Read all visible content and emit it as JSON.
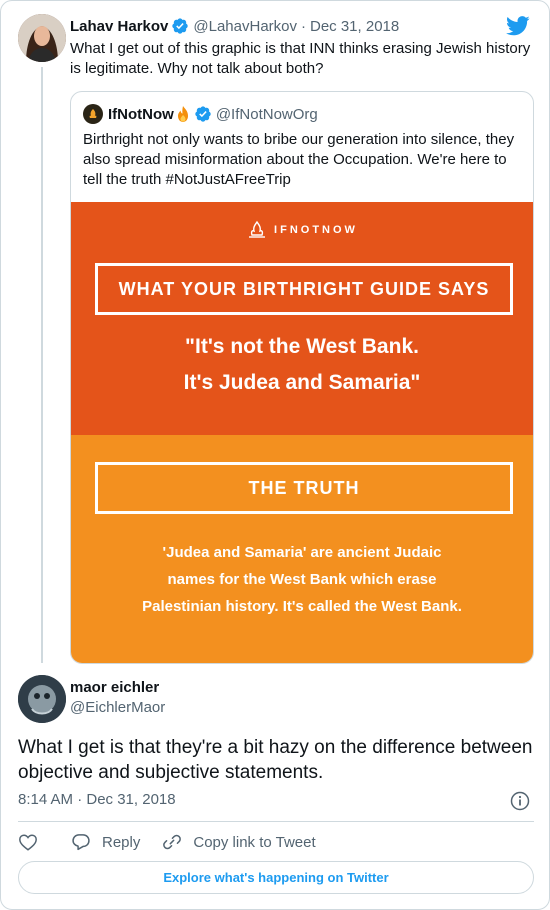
{
  "parent_tweet": {
    "author_name": "Lahav Harkov",
    "author_handle": "@LahavHarkov",
    "separator": "·",
    "date": "Dec 31, 2018",
    "text": "What I get out of this graphic is that INN thinks erasing Jewish history is legitimate. Why not talk about both?"
  },
  "quoted_tweet": {
    "author_name": "IfNotNow",
    "author_handle": "@IfNotNowOrg",
    "text": "Birthright not only wants to bribe our generation into silence, they also spread misinformation about the Occupation. We're here to tell the truth #NotJustAFreeTrip",
    "graphic": {
      "logo_text": "IFNOTNOW",
      "box1_label": "WHAT YOUR BIRTHRIGHT GUIDE SAYS",
      "quote_line1": "\"It's not the West Bank.",
      "quote_line2": "It's Judea and Samaria\"",
      "box2_label": "THE TRUTH",
      "truth_line1": "'Judea and Samaria' are ancient Judaic",
      "truth_line2": "names for the West Bank which erase",
      "truth_line3": "Palestinian history. It's called the West Bank.",
      "top_color": "#e4541a",
      "bottom_color": "#f3901f"
    }
  },
  "reply_tweet": {
    "author_name": "maor eichler",
    "author_handle": "@EichlerMaor",
    "text": "What I get is that they're a bit hazy on the difference between objective and subjective statements.",
    "timestamp": "8:14 AM · Dec 31, 2018"
  },
  "actions": {
    "like_icon": "heart-icon",
    "reply_label": "Reply",
    "copy_link_label": "Copy link to Tweet"
  },
  "explore_label": "Explore what's happening on Twitter",
  "colors": {
    "twitter_blue": "#1d9bf0",
    "text_primary": "#0f1419",
    "text_secondary": "#536471",
    "border": "#cfd9de"
  }
}
